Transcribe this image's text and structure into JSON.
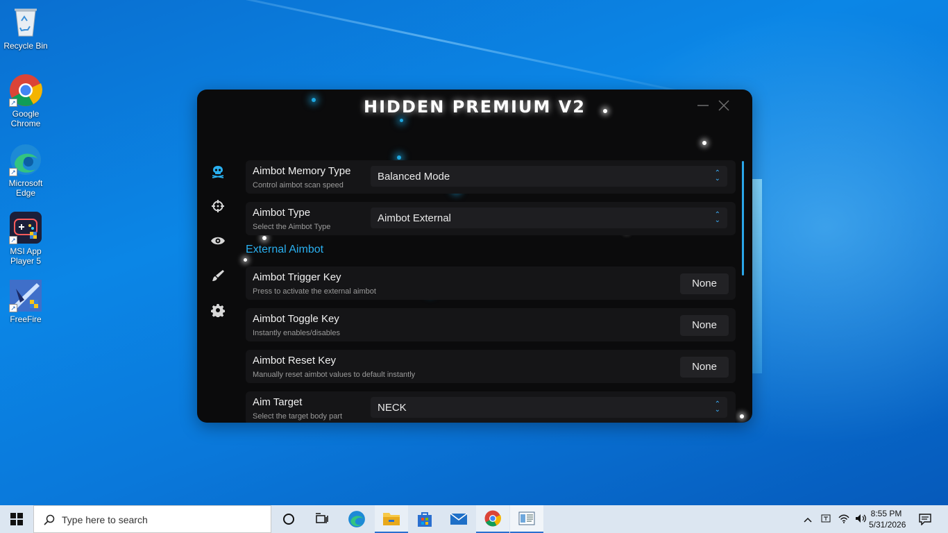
{
  "desktop": {
    "icons": [
      {
        "label": "Recycle Bin",
        "icon": "recycle-bin-icon"
      },
      {
        "label": "Google Chrome",
        "icon": "chrome-icon"
      },
      {
        "label": "Microsoft Edge",
        "icon": "edge-icon"
      },
      {
        "label": "MSI App Player 5",
        "icon": "msi-app-player-icon"
      },
      {
        "label": "FreeFire",
        "icon": "freefire-icon"
      }
    ]
  },
  "app": {
    "title": "HIDDEN PREMIUM V2",
    "nav": [
      "skull-icon",
      "crosshair-icon",
      "eye-icon",
      "brush-icon",
      "gear-icon"
    ],
    "settings": {
      "memory_type": {
        "title": "Aimbot Memory Type",
        "desc": "Control aimbot scan speed",
        "value": "Balanced Mode"
      },
      "aimbot_type": {
        "title": "Aimbot Type",
        "desc": "Select the Aimbot Type",
        "value": "Aimbot External"
      },
      "section": "External Aimbot",
      "trigger_key": {
        "title": "Aimbot Trigger Key",
        "desc": "Press to activate the external aimbot",
        "value": "None"
      },
      "toggle_key": {
        "title": "Aimbot Toggle Key",
        "desc": "Instantly enables/disables",
        "value": "None"
      },
      "reset_key": {
        "title": "Aimbot Reset Key",
        "desc": "Manually reset aimbot values to default instantly",
        "value": "None"
      },
      "aim_target": {
        "title": "Aim Target",
        "desc": "Select the target body part",
        "value": "NECK"
      }
    },
    "accent": "#2ab0f0"
  },
  "taskbar": {
    "search_placeholder": "Type here to search",
    "time": "8:55 PM",
    "date": "5/31/2026"
  }
}
